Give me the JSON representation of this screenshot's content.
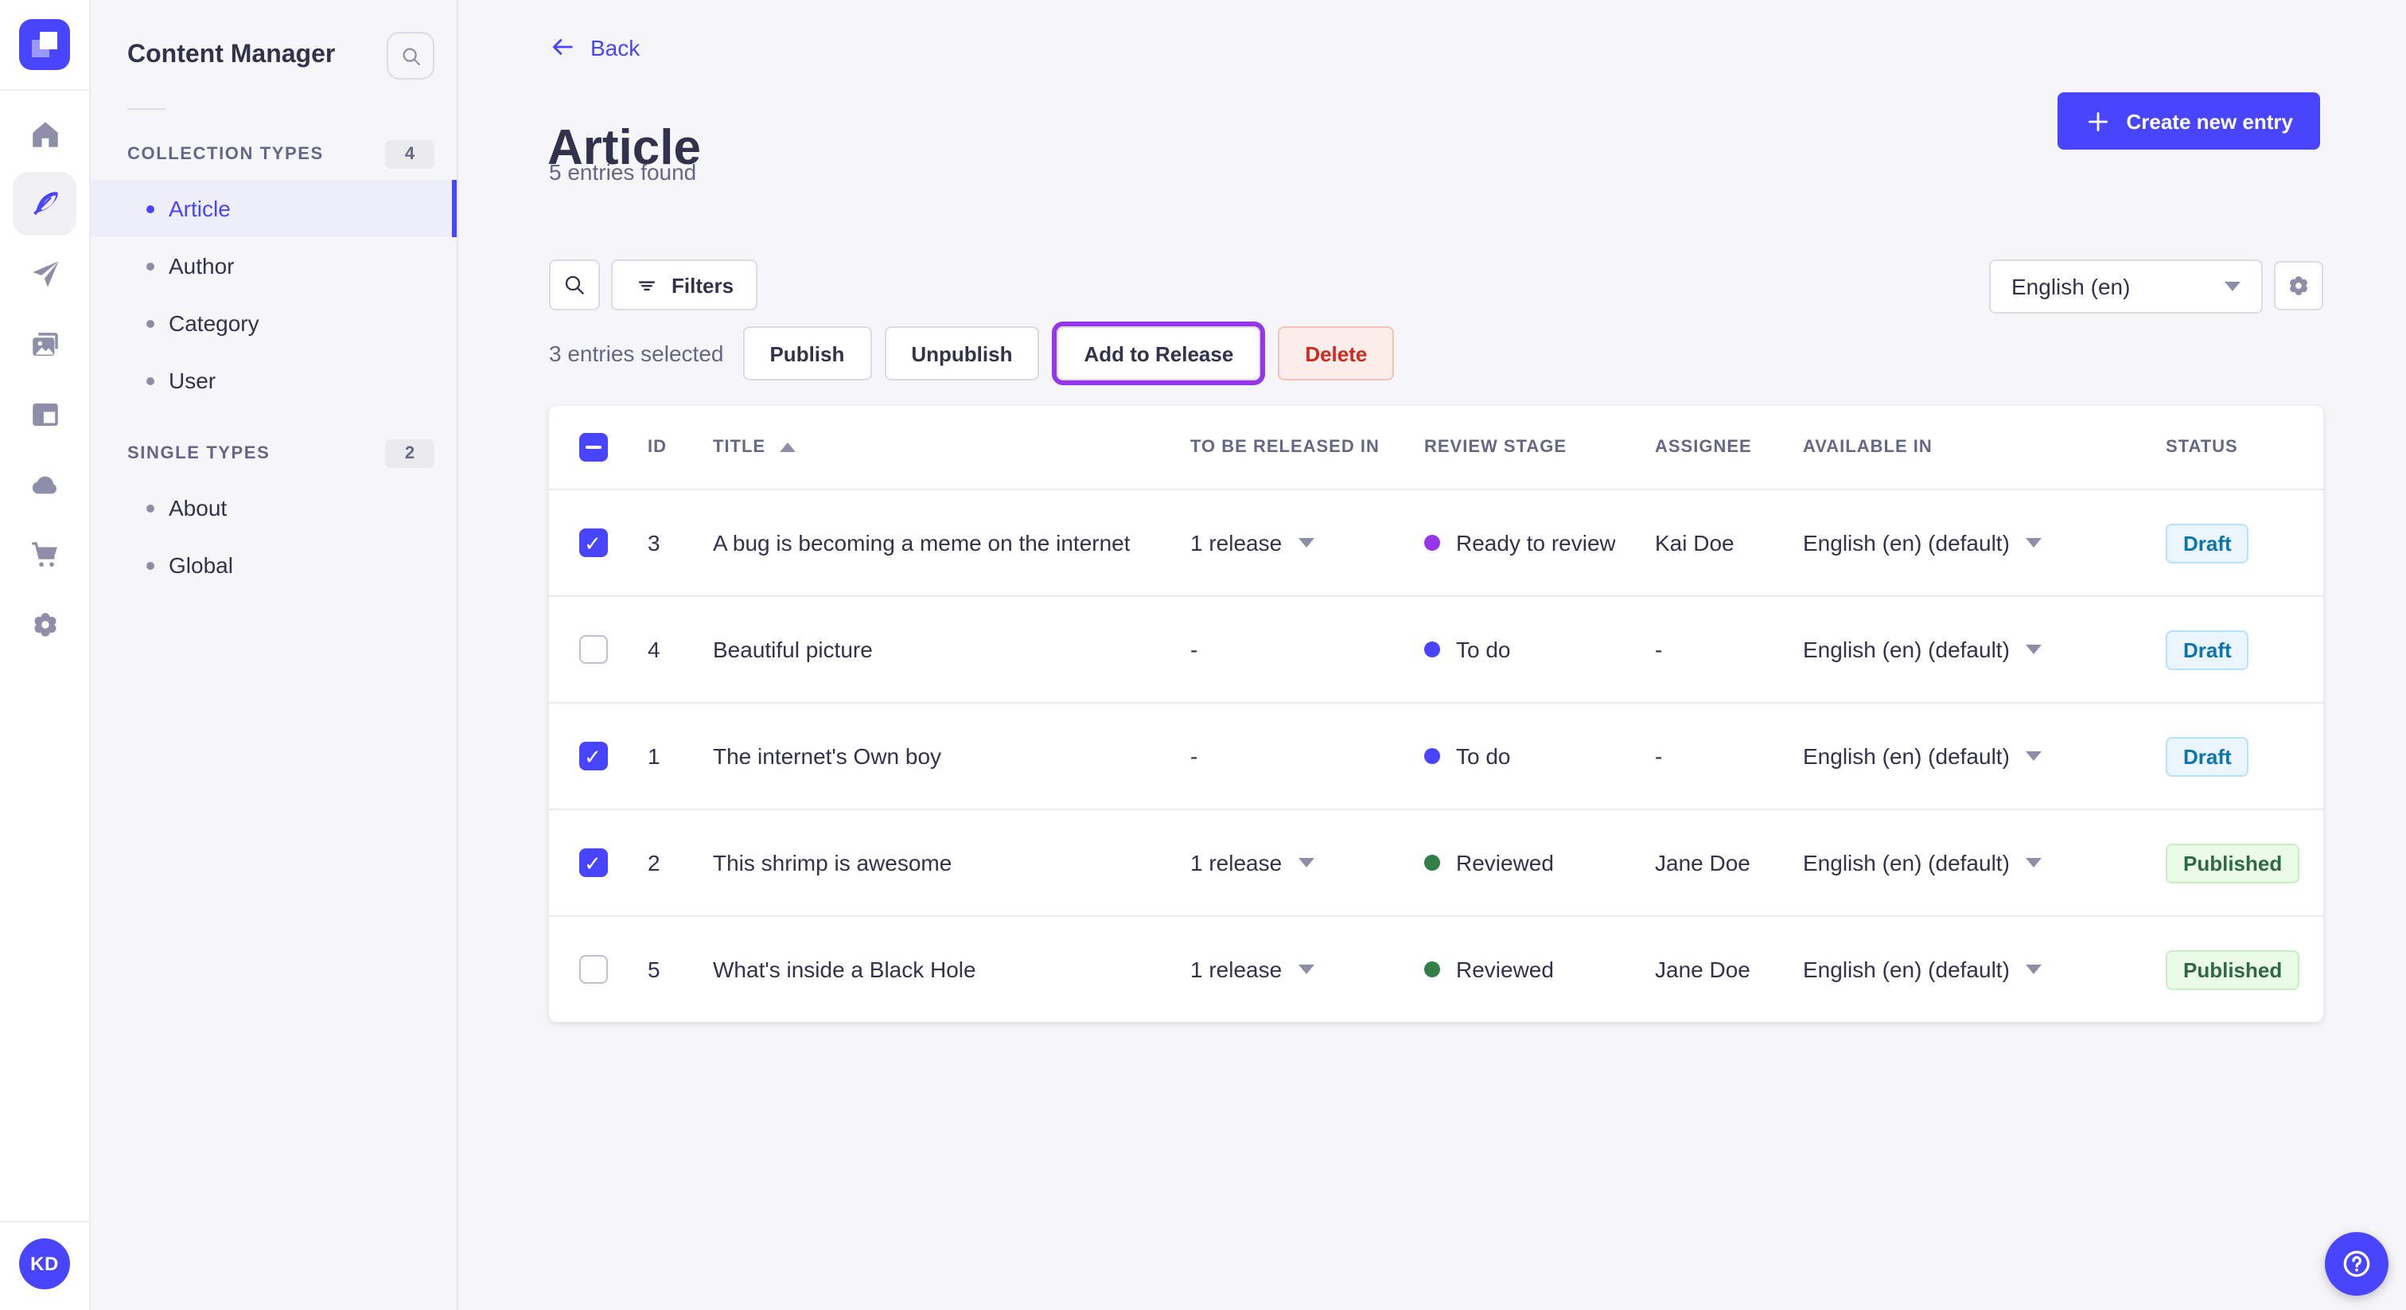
{
  "app": {
    "brand_color": "#4945ff",
    "avatar_initials": "KD",
    "nav_rail_icons": [
      "strapi-logo",
      "home",
      "content-manager (feather, active)",
      "releases (paper-plane)",
      "media-library (pictures)",
      "content-type-builder (layout)",
      "cloud",
      "marketplace (cart)",
      "settings (gear)"
    ],
    "help_icon": "question-mark-circle"
  },
  "subnav": {
    "title": "Content Manager",
    "search_icon": "magnifier",
    "sections": [
      {
        "label": "COLLECTION TYPES",
        "count": "4",
        "items": [
          {
            "label": "Article",
            "active": true
          },
          {
            "label": "Author",
            "active": false
          },
          {
            "label": "Category",
            "active": false
          },
          {
            "label": "User",
            "active": false
          }
        ]
      },
      {
        "label": "SINGLE TYPES",
        "count": "2",
        "items": [
          {
            "label": "About",
            "active": false
          },
          {
            "label": "Global",
            "active": false
          }
        ]
      }
    ]
  },
  "page_header": {
    "back": "Back",
    "title": "Article",
    "subtitle": "5 entries found",
    "create_button": "Create new entry"
  },
  "toolbar": {
    "filters": "Filters",
    "locale": "English (en)"
  },
  "selection_bar": {
    "summary": "3 entries selected",
    "publish": "Publish",
    "unpublish": "Unpublish",
    "add_to_release": "Add to Release",
    "delete": "Delete",
    "highlight_ring_color": "#9736e8"
  },
  "table": {
    "select_all_state": "indeterminate",
    "sort": {
      "column": "TITLE",
      "direction": "asc"
    },
    "header": {
      "id": "ID",
      "title": "TITLE",
      "release": "TO BE RELEASED IN",
      "stage": "REVIEW STAGE",
      "assignee": "ASSIGNEE",
      "available": "AVAILABLE IN",
      "status": "STATUS"
    },
    "stage_colors": {
      "Ready to review": "#9736e8",
      "To do": "#4945ff",
      "Reviewed": "#328048"
    },
    "status_styles": {
      "Draft": {
        "bg": "#eaf5ff",
        "border": "#b8e1ff",
        "text": "#0c75af"
      },
      "Published": {
        "bg": "#eafbe7",
        "border": "#c6f0c2",
        "text": "#2f6846"
      }
    },
    "rows": [
      {
        "checked": true,
        "id": "3",
        "title": "A bug is becoming a meme on the internet",
        "release": "1 release",
        "stage": "Ready to review",
        "assignee": "Kai Doe",
        "locale": "English (en) (default)",
        "status": "Draft"
      },
      {
        "checked": false,
        "id": "4",
        "title": "Beautiful picture",
        "release": "-",
        "stage": "To do",
        "assignee": "-",
        "locale": "English (en) (default)",
        "status": "Draft"
      },
      {
        "checked": true,
        "id": "1",
        "title": "The internet's Own boy",
        "release": "-",
        "stage": "To do",
        "assignee": "-",
        "locale": "English (en) (default)",
        "status": "Draft"
      },
      {
        "checked": true,
        "id": "2",
        "title": "This shrimp is awesome",
        "release": "1 release",
        "stage": "Reviewed",
        "assignee": "Jane Doe",
        "locale": "English (en) (default)",
        "status": "Published"
      },
      {
        "checked": false,
        "id": "5",
        "title": "What's inside a Black Hole",
        "release": "1 release",
        "stage": "Reviewed",
        "assignee": "Jane Doe",
        "locale": "English (en) (default)",
        "status": "Published"
      }
    ]
  }
}
